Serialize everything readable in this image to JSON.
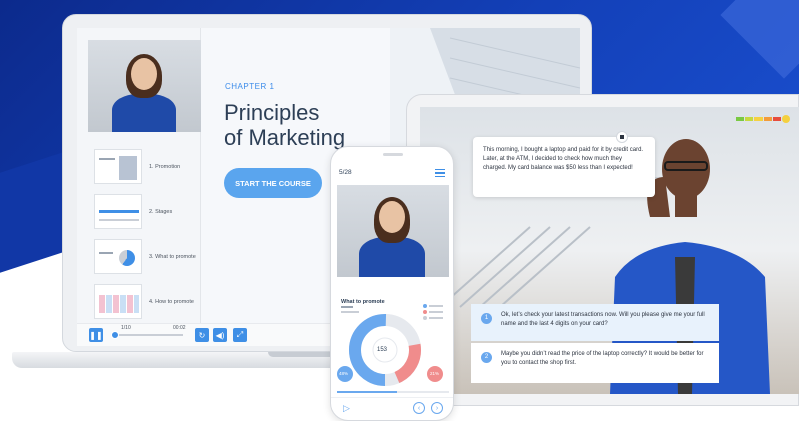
{
  "laptop": {
    "chapter": "CHAPTER 1",
    "title_line1": "Principles",
    "title_line2": "of Marketing",
    "start_button": "START THE COURSE",
    "slides": [
      {
        "label": "1. Promotion"
      },
      {
        "label": "2. Stages"
      },
      {
        "label": "3. What to promote"
      },
      {
        "label": "4. How to promote"
      }
    ],
    "player": {
      "pause_icon": "pause-icon",
      "progress": "1/10",
      "time": "00:02",
      "replay_icon": "replay-icon",
      "volume_icon": "volume-icon",
      "fullscreen_icon": "expand-icon"
    }
  },
  "tablet": {
    "speech": "This morning, I bought a laptop and paid for it by credit card. Later, at the ATM, I decided to check how much they charged. My card balance was $50 less than I expected!",
    "answers": [
      {
        "num": "1",
        "text": "Ok, let’s check your latest transactions now. Will you please give me your full name and the last 4 digits on your card?"
      },
      {
        "num": "2",
        "text": "Maybe you didn’t read the price of the laptop correctly? It would be better for you to contact the shop first."
      }
    ],
    "mood_colors": [
      "#7ac943",
      "#c7d93f",
      "#f5d142",
      "#f39c3a",
      "#e74c3c"
    ]
  },
  "phone": {
    "page": "5/28",
    "slide_title": "What to promote",
    "center_value": "153",
    "left_badge": "48%",
    "right_badge": "21%"
  }
}
